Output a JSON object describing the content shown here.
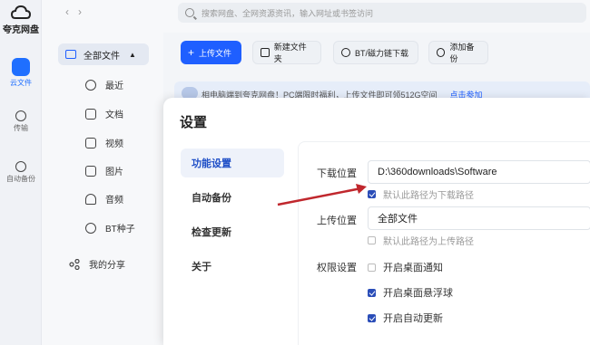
{
  "app": {
    "name": "夸克网盘"
  },
  "rail": [
    {
      "label": "云文件",
      "active": true
    },
    {
      "label": "传输",
      "active": false
    },
    {
      "label": "自动备份",
      "active": false
    }
  ],
  "nav": {
    "back": "‹",
    "forward": "›"
  },
  "search": {
    "placeholder": "搜索网盘、全网资源资讯，输入网址或书签访问"
  },
  "sidebar": {
    "root": "全部文件",
    "items": [
      {
        "label": "最近",
        "icon": "clock-icon"
      },
      {
        "label": "文档",
        "icon": "document-icon"
      },
      {
        "label": "视频",
        "icon": "video-icon"
      },
      {
        "label": "图片",
        "icon": "image-icon"
      },
      {
        "label": "音频",
        "icon": "headphones-icon"
      },
      {
        "label": "BT种子",
        "icon": "link-icon"
      }
    ],
    "share": "我的分享"
  },
  "toolbar": {
    "upload": "上传文件",
    "new_folder": "新建文件夹",
    "bt_download": "BT/磁力链下载",
    "add_backup": "添加备份"
  },
  "banner": {
    "text": "相电脑端到夸克网盘！PC端限时福利，上传文件即可领512G空间",
    "link": "点击参加"
  },
  "settings": {
    "title": "设置",
    "tabs": [
      "功能设置",
      "自动备份",
      "检查更新",
      "关于"
    ],
    "download_label": "下载位置",
    "download_path": "D:\\360downloads\\Software",
    "download_default": "默认此路径为下载路径",
    "upload_label": "上传位置",
    "upload_path": "全部文件",
    "upload_default": "默认此路径为上传路径",
    "perm_label": "权限设置",
    "perms": [
      {
        "label": "开启桌面通知",
        "checked": false
      },
      {
        "label": "开启桌面悬浮球",
        "checked": true
      },
      {
        "label": "开启自动更新",
        "checked": true
      }
    ]
  },
  "colors": {
    "accent": "#1f5fff",
    "annotation_arrow": "#c0272d"
  }
}
